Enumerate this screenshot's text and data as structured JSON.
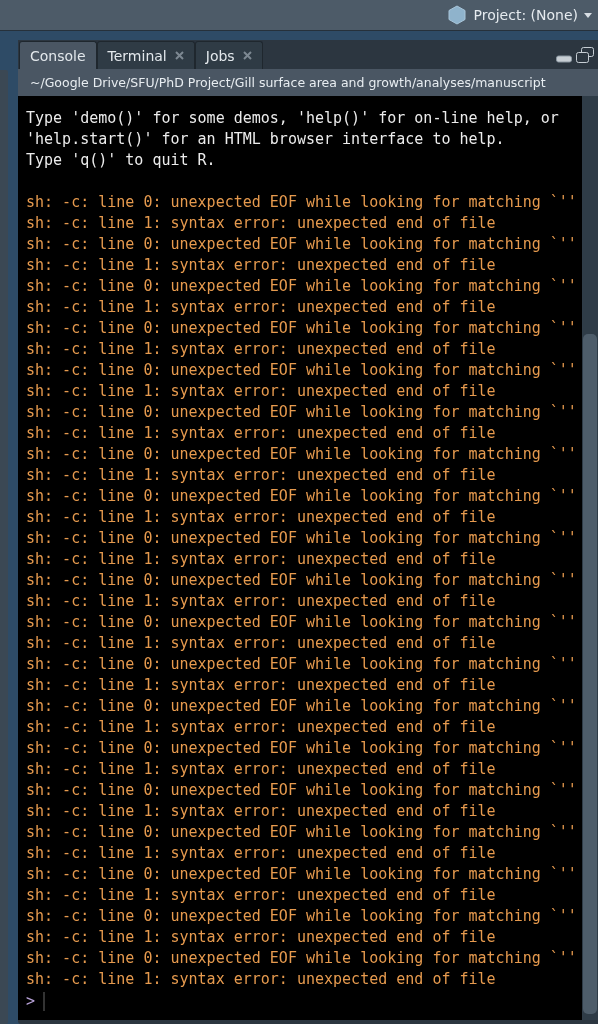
{
  "toolbar": {
    "project": "Project: (None)"
  },
  "tabs": [
    {
      "label": "Console",
      "selected": true,
      "closable": false
    },
    {
      "label": "Terminal",
      "selected": false,
      "closable": true
    },
    {
      "label": "Jobs",
      "selected": false,
      "closable": true
    }
  ],
  "path": "~/Google Drive/SFU/PhD Project/Gill surface area and growth/analyses/manuscript",
  "console": {
    "lines": [
      {
        "kind": "message",
        "text": "Type 'demo()' for some demos, 'help()' for on-line help, or"
      },
      {
        "kind": "message",
        "text": "'help.start()' for an HTML browser interface to help."
      },
      {
        "kind": "message",
        "text": "Type 'q()' to quit R."
      },
      {
        "kind": "blank"
      },
      {
        "kind": "error",
        "text": "sh: -c: line 0: unexpected EOF while looking for matching `''"
      },
      {
        "kind": "error",
        "text": "sh: -c: line 1: syntax error: unexpected end of file"
      },
      {
        "kind": "error",
        "text": "sh: -c: line 0: unexpected EOF while looking for matching `''"
      },
      {
        "kind": "error",
        "text": "sh: -c: line 1: syntax error: unexpected end of file"
      },
      {
        "kind": "error",
        "text": "sh: -c: line 0: unexpected EOF while looking for matching `''"
      },
      {
        "kind": "error",
        "text": "sh: -c: line 1: syntax error: unexpected end of file"
      },
      {
        "kind": "error",
        "text": "sh: -c: line 0: unexpected EOF while looking for matching `''"
      },
      {
        "kind": "error",
        "text": "sh: -c: line 1: syntax error: unexpected end of file"
      },
      {
        "kind": "error",
        "text": "sh: -c: line 0: unexpected EOF while looking for matching `''"
      },
      {
        "kind": "error",
        "text": "sh: -c: line 1: syntax error: unexpected end of file"
      },
      {
        "kind": "error",
        "text": "sh: -c: line 0: unexpected EOF while looking for matching `''"
      },
      {
        "kind": "error",
        "text": "sh: -c: line 1: syntax error: unexpected end of file"
      },
      {
        "kind": "error",
        "text": "sh: -c: line 0: unexpected EOF while looking for matching `''"
      },
      {
        "kind": "error",
        "text": "sh: -c: line 1: syntax error: unexpected end of file"
      },
      {
        "kind": "error",
        "text": "sh: -c: line 0: unexpected EOF while looking for matching `''"
      },
      {
        "kind": "error",
        "text": "sh: -c: line 1: syntax error: unexpected end of file"
      },
      {
        "kind": "error",
        "text": "sh: -c: line 0: unexpected EOF while looking for matching `''"
      },
      {
        "kind": "error",
        "text": "sh: -c: line 1: syntax error: unexpected end of file"
      },
      {
        "kind": "error",
        "text": "sh: -c: line 0: unexpected EOF while looking for matching `''"
      },
      {
        "kind": "error",
        "text": "sh: -c: line 1: syntax error: unexpected end of file"
      },
      {
        "kind": "error",
        "text": "sh: -c: line 0: unexpected EOF while looking for matching `''"
      },
      {
        "kind": "error",
        "text": "sh: -c: line 1: syntax error: unexpected end of file"
      },
      {
        "kind": "error",
        "text": "sh: -c: line 0: unexpected EOF while looking for matching `''"
      },
      {
        "kind": "error",
        "text": "sh: -c: line 1: syntax error: unexpected end of file"
      },
      {
        "kind": "error",
        "text": "sh: -c: line 0: unexpected EOF while looking for matching `''"
      },
      {
        "kind": "error",
        "text": "sh: -c: line 1: syntax error: unexpected end of file"
      },
      {
        "kind": "error",
        "text": "sh: -c: line 0: unexpected EOF while looking for matching `''"
      },
      {
        "kind": "error",
        "text": "sh: -c: line 1: syntax error: unexpected end of file"
      },
      {
        "kind": "error",
        "text": "sh: -c: line 0: unexpected EOF while looking for matching `''"
      },
      {
        "kind": "error",
        "text": "sh: -c: line 1: syntax error: unexpected end of file"
      },
      {
        "kind": "error",
        "text": "sh: -c: line 0: unexpected EOF while looking for matching `''"
      },
      {
        "kind": "error",
        "text": "sh: -c: line 1: syntax error: unexpected end of file"
      },
      {
        "kind": "error",
        "text": "sh: -c: line 0: unexpected EOF while looking for matching `''"
      },
      {
        "kind": "error",
        "text": "sh: -c: line 1: syntax error: unexpected end of file"
      },
      {
        "kind": "error",
        "text": "sh: -c: line 0: unexpected EOF while looking for matching `''"
      },
      {
        "kind": "error",
        "text": "sh: -c: line 1: syntax error: unexpected end of file"
      },
      {
        "kind": "error",
        "text": "sh: -c: line 0: unexpected EOF while looking for matching `''"
      },
      {
        "kind": "error",
        "text": "sh: -c: line 1: syntax error: unexpected end of file"
      }
    ],
    "prompt": ">"
  }
}
